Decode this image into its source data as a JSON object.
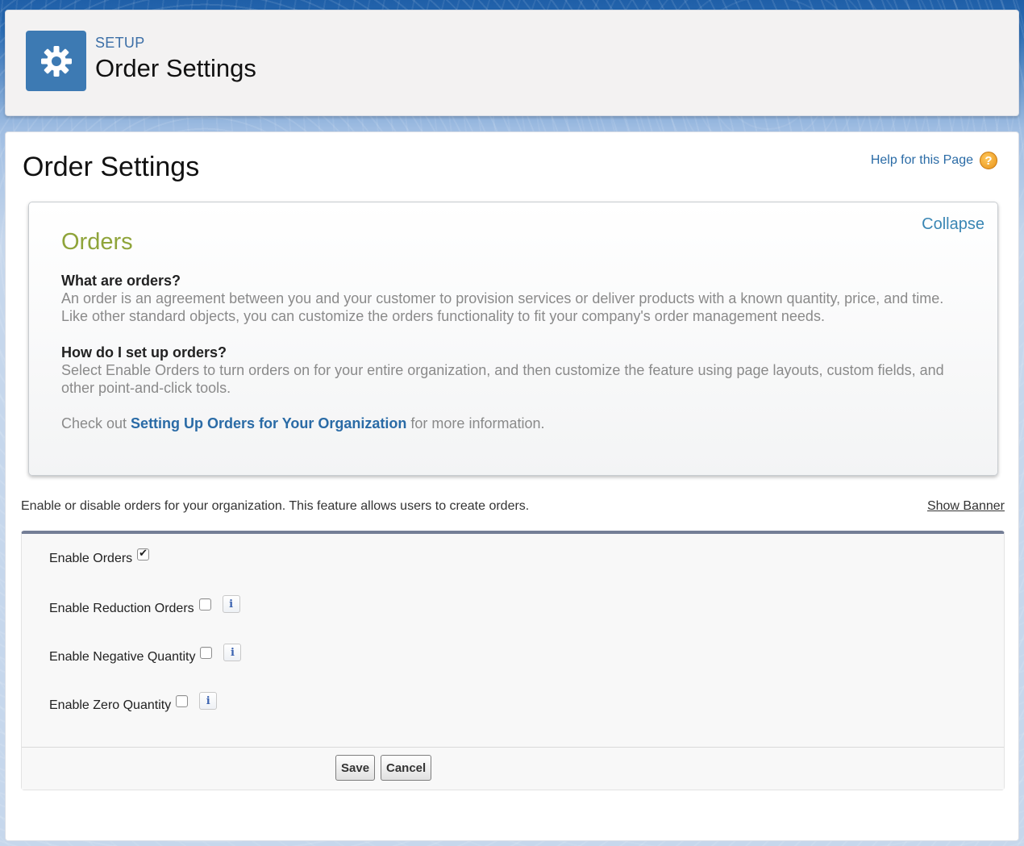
{
  "header": {
    "setup_label": "SETUP",
    "title": "Order Settings",
    "icon": "gear-icon"
  },
  "page": {
    "title": "Order Settings",
    "help_link": "Help for this Page",
    "help_icon": "question-icon"
  },
  "banner": {
    "collapse_label": "Collapse",
    "title": "Orders",
    "q1": "What are orders?",
    "a1": "An order is an agreement between you and your customer to provision services or deliver products with a known quantity, price, and time. Like other standard objects, you can customize the orders functionality to fit your company's order management needs.",
    "q2": "How do I set up orders?",
    "a2": "Select Enable Orders to turn orders on for your entire organization, and then customize the feature using page layouts, custom fields, and other point-and-click tools.",
    "more_prefix": "Check out ",
    "more_link": "Setting Up Orders for Your Organization",
    "more_suffix": " for more information."
  },
  "description": {
    "text": "Enable or disable orders for your organization. This feature allows users to create orders.",
    "show_banner": "Show Banner"
  },
  "settings": [
    {
      "label": "Enable Orders",
      "checked": true,
      "info": false
    },
    {
      "label": "Enable Reduction Orders",
      "checked": false,
      "info": true
    },
    {
      "label": "Enable Negative Quantity",
      "checked": false,
      "info": true
    },
    {
      "label": "Enable Zero Quantity",
      "checked": false,
      "info": true
    }
  ],
  "info_glyph": "i",
  "buttons": {
    "save": "Save",
    "cancel": "Cancel"
  },
  "colors": {
    "setup_icon_bg": "#3d7ab3",
    "banner_title": "#8fa43a",
    "link": "#2a6ba6",
    "settings_top_border": "#747e96"
  }
}
